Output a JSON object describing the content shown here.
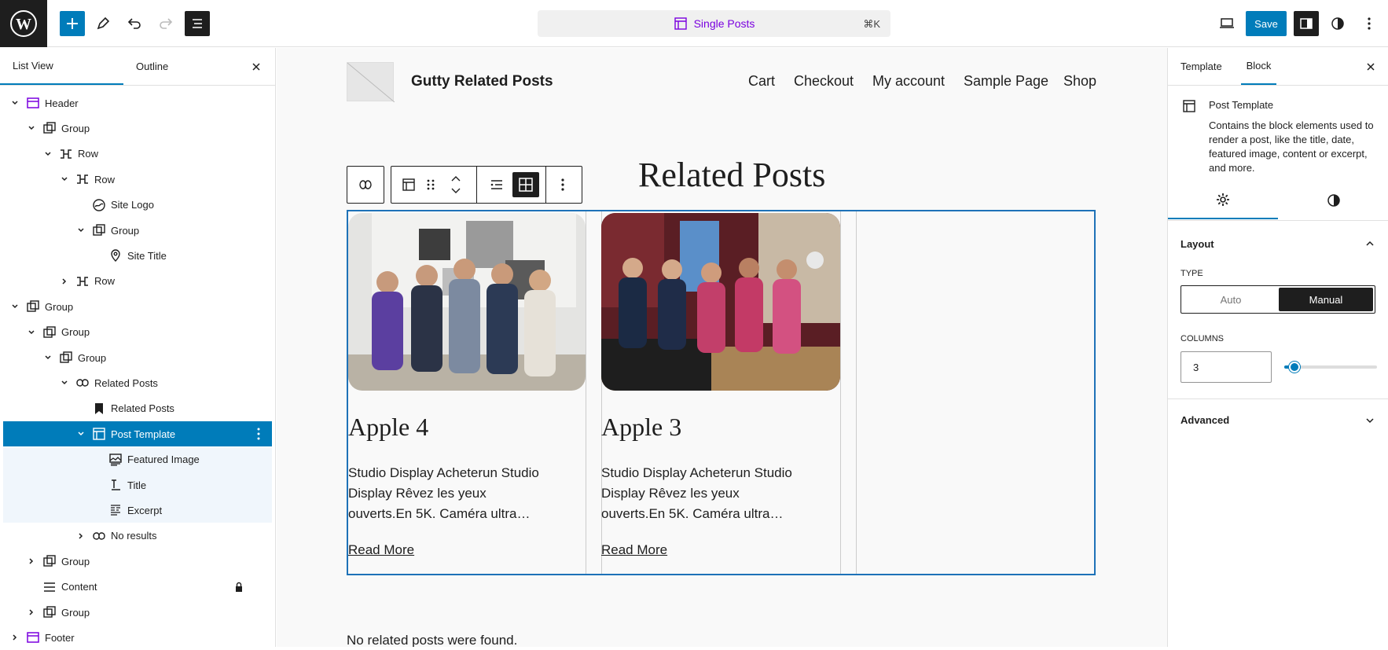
{
  "topbar": {
    "document_title": "Single Posts",
    "shortcut": "⌘K",
    "save_label": "Save"
  },
  "left_panel": {
    "tabs": [
      "List View",
      "Outline"
    ],
    "tree": [
      {
        "label": "Header",
        "icon": "template-part-icon"
      },
      {
        "label": "Group",
        "icon": "group-icon"
      },
      {
        "label": "Row",
        "icon": "row-icon"
      },
      {
        "label": "Row",
        "icon": "row-icon"
      },
      {
        "label": "Site Logo",
        "icon": "site-logo-icon"
      },
      {
        "label": "Group",
        "icon": "group-icon"
      },
      {
        "label": "Site Title",
        "icon": "map-pin-icon"
      },
      {
        "label": "Row",
        "icon": "row-icon"
      },
      {
        "label": "Group",
        "icon": "group-icon"
      },
      {
        "label": "Group",
        "icon": "group-icon"
      },
      {
        "label": "Group",
        "icon": "group-icon"
      },
      {
        "label": "Related Posts",
        "icon": "loop-icon"
      },
      {
        "label": "Related Posts",
        "icon": "bookmark-icon"
      },
      {
        "label": "Post Template",
        "icon": "layout-icon"
      },
      {
        "label": "Featured Image",
        "icon": "image-icon"
      },
      {
        "label": "Title",
        "icon": "title-icon"
      },
      {
        "label": "Excerpt",
        "icon": "excerpt-icon"
      },
      {
        "label": "No results",
        "icon": "loop-icon"
      },
      {
        "label": "Group",
        "icon": "group-icon"
      },
      {
        "label": "Content",
        "icon": "align-justify-icon"
      },
      {
        "label": "Group",
        "icon": "group-icon"
      },
      {
        "label": "Footer",
        "icon": "template-part-icon"
      }
    ]
  },
  "canvas": {
    "site_title": "Gutty Related Posts",
    "nav": [
      "Cart",
      "Checkout",
      "My account",
      "Sample Page",
      "Shop"
    ],
    "heading": "Related Posts",
    "posts": [
      {
        "title": "Apple 4",
        "excerpt": "Studio Display Acheterun Studio Display Rêvez les yeux ouverts.En 5K. Caméra ultra…",
        "more": "Read More"
      },
      {
        "title": "Apple 3",
        "excerpt": "Studio Display Acheterun Studio Display Rêvez les yeux ouverts.En 5K. Caméra ultra…",
        "more": "Read More"
      }
    ],
    "no_results": "No related posts were found."
  },
  "right_panel": {
    "tabs": [
      "Template",
      "Block"
    ],
    "block_name": "Post Template",
    "block_description": "Contains the block elements used to render a post, like the title, date, featured image, content or excerpt, and more.",
    "layout_title": "Layout",
    "type_label": "TYPE",
    "type_options": [
      "Auto",
      "Manual"
    ],
    "type_selected": "Manual",
    "columns_label": "COLUMNS",
    "columns_value": "3",
    "columns_slider_fraction": 0.05,
    "advanced_title": "Advanced"
  },
  "colors": {
    "accent": "#007cba",
    "template_part": "#7a00df"
  }
}
